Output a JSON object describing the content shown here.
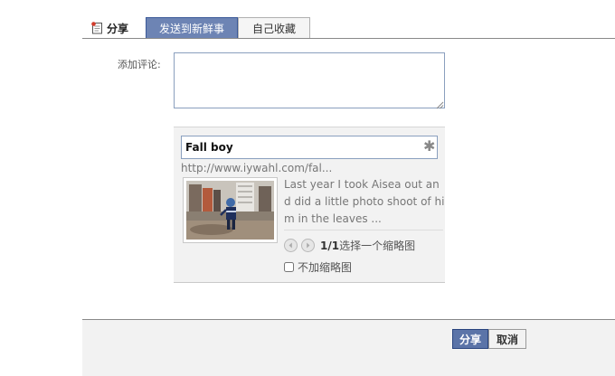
{
  "header": {
    "share_label": "分享",
    "tabs": [
      {
        "label": "发送到新鲜事",
        "active": true
      },
      {
        "label": "自己收藏",
        "active": false
      }
    ]
  },
  "comment": {
    "label": "添加评论:",
    "value": ""
  },
  "preview": {
    "title": "Fall boy",
    "url": "http://www.iywahl.com/fal...",
    "description": "Last year I took Aisea out and did a little photo shoot of him in the leaves ...",
    "thumbnail_count_current": "1/1",
    "thumbnail_select_label": "选择一个缩略图",
    "no_thumbnail_label": "不加缩略图",
    "no_thumbnail_checked": false
  },
  "footer": {
    "share_button": "分享",
    "cancel_button": "取消"
  },
  "colors": {
    "accent": "#6d84b4",
    "accent_border": "#3b5998",
    "share_button": "#5b74a8"
  }
}
